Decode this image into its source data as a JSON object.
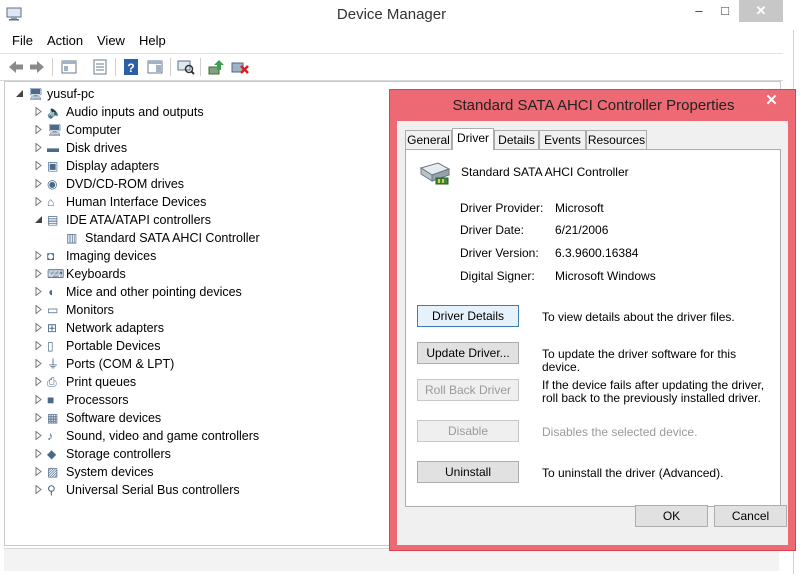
{
  "window": {
    "title": "Device Manager",
    "controls": {
      "minimize": "–",
      "maximize": "□",
      "close": "✕"
    }
  },
  "menu": [
    "File",
    "Action",
    "View",
    "Help"
  ],
  "toolbar": {
    "icons": [
      "back-icon",
      "forward-icon",
      "show-hide-tree-icon",
      "properties-icon",
      "help-icon",
      "action-pane-icon",
      "scan-hardware-icon",
      "update-driver-icon",
      "disable-uninstall-icon"
    ]
  },
  "tree": {
    "root": "yusuf-pc",
    "categories": [
      {
        "label": "Audio inputs and outputs",
        "icon": "speaker-icon"
      },
      {
        "label": "Computer",
        "icon": "computer-icon"
      },
      {
        "label": "Disk drives",
        "icon": "disk-drive-icon"
      },
      {
        "label": "Display adapters",
        "icon": "display-adapter-icon"
      },
      {
        "label": "DVD/CD-ROM drives",
        "icon": "dvd-drive-icon"
      },
      {
        "label": "Human Interface Devices",
        "icon": "hid-icon"
      },
      {
        "label": "IDE ATA/ATAPI controllers",
        "icon": "ide-controller-icon",
        "expanded": true
      },
      {
        "label": "Standard SATA AHCI Controller",
        "icon": "controller-device-icon",
        "child": true
      },
      {
        "label": "Imaging devices",
        "icon": "camera-icon"
      },
      {
        "label": "Keyboards",
        "icon": "keyboard-icon"
      },
      {
        "label": "Mice and other pointing devices",
        "icon": "mouse-icon"
      },
      {
        "label": "Monitors",
        "icon": "monitor-icon"
      },
      {
        "label": "Network adapters",
        "icon": "network-icon"
      },
      {
        "label": "Portable Devices",
        "icon": "portable-device-icon"
      },
      {
        "label": "Ports (COM & LPT)",
        "icon": "port-icon"
      },
      {
        "label": "Print queues",
        "icon": "printer-icon"
      },
      {
        "label": "Processors",
        "icon": "processor-icon"
      },
      {
        "label": "Software devices",
        "icon": "software-device-icon"
      },
      {
        "label": "Sound, video and game controllers",
        "icon": "sound-icon"
      },
      {
        "label": "Storage controllers",
        "icon": "storage-icon"
      },
      {
        "label": "System devices",
        "icon": "system-device-icon"
      },
      {
        "label": "Universal Serial Bus controllers",
        "icon": "usb-icon"
      }
    ]
  },
  "dialog": {
    "title": "Standard SATA AHCI Controller Properties",
    "close": "✕",
    "accent": "#ed6973",
    "tabs": [
      "General",
      "Driver",
      "Details",
      "Events",
      "Resources"
    ],
    "active_tab": "Driver",
    "device_name": "Standard SATA AHCI Controller",
    "fields": [
      {
        "label": "Driver Provider:",
        "value": "Microsoft"
      },
      {
        "label": "Driver Date:",
        "value": "6/21/2006"
      },
      {
        "label": "Driver Version:",
        "value": "6.3.9600.16384"
      },
      {
        "label": "Digital Signer:",
        "value": "Microsoft Windows"
      }
    ],
    "actions": [
      {
        "button": "Driver Details",
        "desc": "To view details about the driver files.",
        "enabled": true
      },
      {
        "button": "Update Driver...",
        "desc": "To update the driver software for this device.",
        "enabled": true
      },
      {
        "button": "Roll Back Driver",
        "desc": "If the device fails after updating the driver, roll back to the previously installed driver.",
        "enabled": false
      },
      {
        "button": "Disable",
        "desc": "Disables the selected device.",
        "enabled": false
      },
      {
        "button": "Uninstall",
        "desc": "To uninstall the driver (Advanced).",
        "enabled": true
      }
    ],
    "ok": "OK",
    "cancel": "Cancel"
  }
}
